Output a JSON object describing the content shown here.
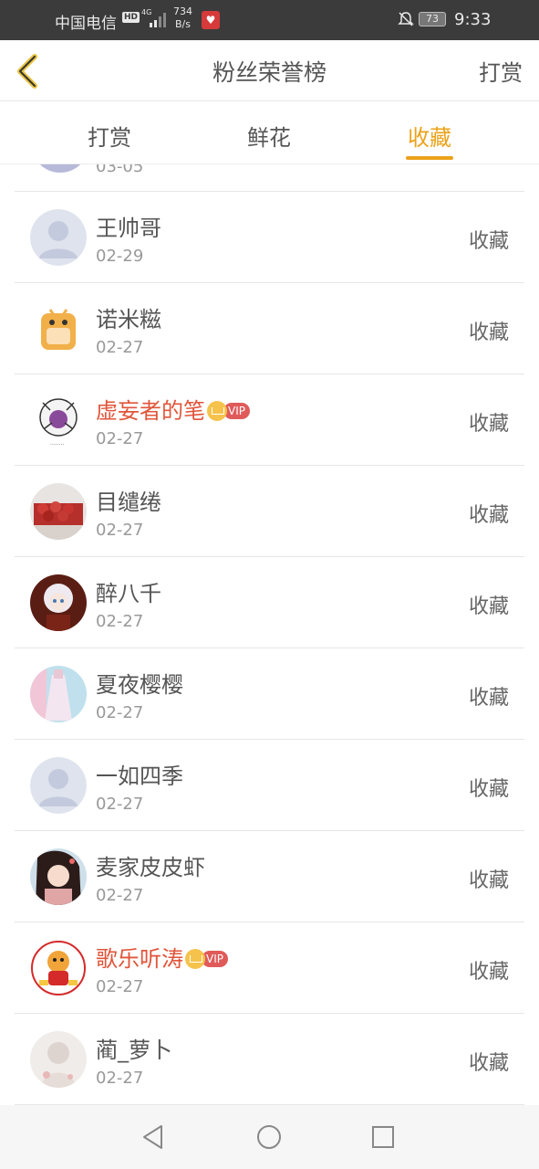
{
  "status_bar": {
    "carrier": "中国电信",
    "hd": "HD",
    "network": "4G",
    "speed_value": "734",
    "speed_unit": "B/s",
    "battery": "73",
    "time": "9:33"
  },
  "header": {
    "title": "粉丝荣誉榜",
    "action_label": "打赏"
  },
  "tabs": [
    {
      "label": "打赏",
      "active": false
    },
    {
      "label": "鲜花",
      "active": false
    },
    {
      "label": "收藏",
      "active": true
    }
  ],
  "partial_row": {
    "date": "03-05"
  },
  "rows": [
    {
      "name": "王帅哥",
      "date": "02-29",
      "action": "收藏",
      "vip": false,
      "avatar": "default-avatar"
    },
    {
      "name": "诺米糍",
      "date": "02-27",
      "action": "收藏",
      "vip": false,
      "avatar": "cartoon-backpack-avatar"
    },
    {
      "name": "虚妄者的笔",
      "date": "02-27",
      "action": "收藏",
      "vip": true,
      "vip_label": "VIP",
      "avatar": "sketch-character-avatar"
    },
    {
      "name": "目缱绻",
      "date": "02-27",
      "action": "收藏",
      "vip": false,
      "avatar": "fruit-photo-avatar"
    },
    {
      "name": "醉八千",
      "date": "02-27",
      "action": "收藏",
      "vip": false,
      "avatar": "anime-white-hair-avatar"
    },
    {
      "name": "夏夜樱樱",
      "date": "02-27",
      "action": "收藏",
      "vip": false,
      "avatar": "dress-photo-avatar"
    },
    {
      "name": "一如四季",
      "date": "02-27",
      "action": "收藏",
      "vip": false,
      "avatar": "default-avatar"
    },
    {
      "name": "麦家皮皮虾",
      "date": "02-27",
      "action": "收藏",
      "vip": false,
      "avatar": "anime-girl-avatar"
    },
    {
      "name": "歌乐听涛",
      "date": "02-27",
      "action": "收藏",
      "vip": true,
      "vip_label": "VIP",
      "avatar": "cartoon-tiger-avatar"
    },
    {
      "name": "蔺_萝卜",
      "date": "02-27",
      "action": "收藏",
      "vip": false,
      "avatar": "pale-illustration-avatar"
    }
  ],
  "colors": {
    "accent": "#eba21a",
    "vip_name": "#e0553a",
    "status_bar_bg": "#3b3b3b",
    "divider": "#e6e6e6"
  }
}
